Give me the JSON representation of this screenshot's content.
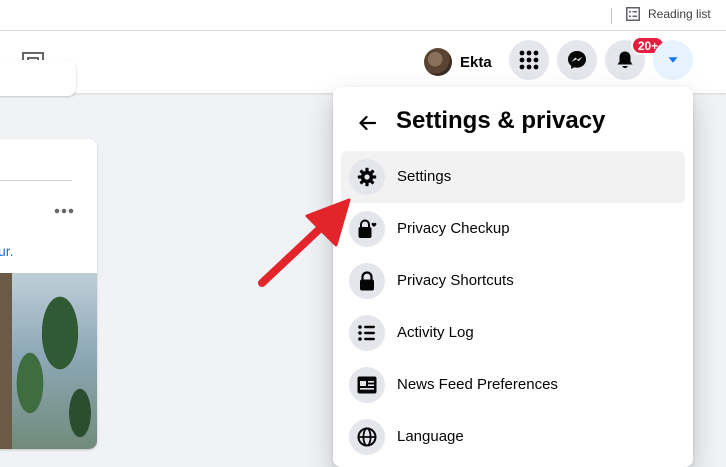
{
  "browser": {
    "reading_list_label": "Reading list"
  },
  "header": {
    "profile_name": "Ekta",
    "notifications_badge": "20+"
  },
  "feed": {
    "post_link_text": "ur."
  },
  "dropdown": {
    "title": "Settings & privacy",
    "items": [
      {
        "label": "Settings",
        "icon": "gear-icon"
      },
      {
        "label": "Privacy Checkup",
        "icon": "lock-heart-icon"
      },
      {
        "label": "Privacy Shortcuts",
        "icon": "lock-icon"
      },
      {
        "label": "Activity Log",
        "icon": "list-icon"
      },
      {
        "label": "News Feed Preferences",
        "icon": "feed-icon"
      },
      {
        "label": "Language",
        "icon": "globe-icon"
      }
    ]
  },
  "colors": {
    "page_bg": "#f0f2f5",
    "accent_blue": "#1877f2",
    "badge_red": "#e41e3f",
    "annotation_red": "#e3242b"
  }
}
